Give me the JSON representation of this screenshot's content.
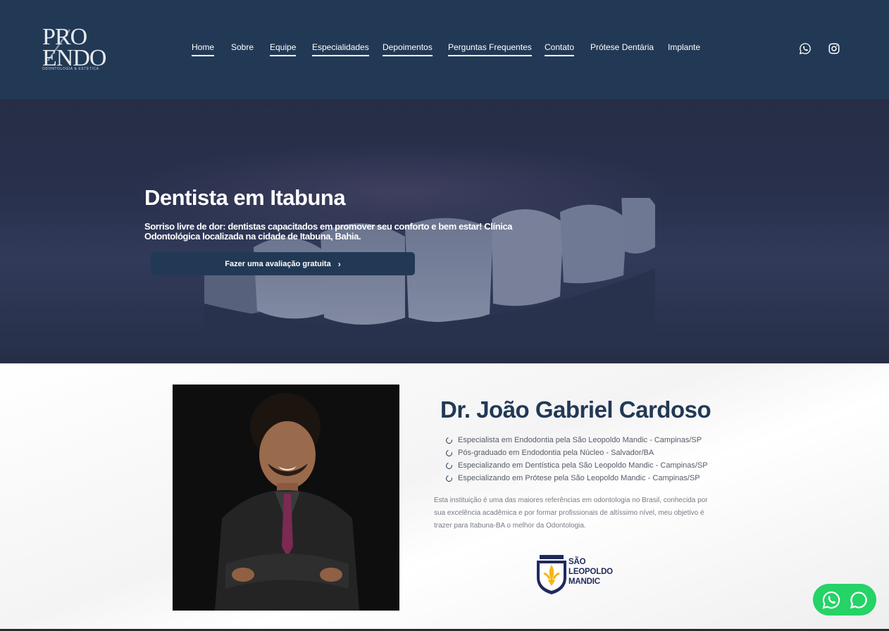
{
  "brand": {
    "logo_line1": "PRO",
    "logo_line2": "ENDO",
    "logo_tagline": "ODONTOLOGIA & ESTÉTICA"
  },
  "nav": {
    "items": [
      {
        "label": "Home"
      },
      {
        "label": "Sobre"
      },
      {
        "label": "Equipe"
      },
      {
        "label": "Especialidades"
      },
      {
        "label": "Depoimentos"
      },
      {
        "label": "Perguntas Frequentes"
      },
      {
        "label": "Contato"
      },
      {
        "label": "Prótese Dentária"
      },
      {
        "label": "Implante"
      }
    ]
  },
  "social": {
    "whatsapp_icon": "whatsapp-icon",
    "instagram_icon": "instagram-icon"
  },
  "hero": {
    "title": "Dentista em Itabuna",
    "subtitle": "Sorriso livre de dor: dentistas capacitados  em promover seu conforto e bem estar! Clínica Odontológica localizada na cidade de Itabuna, Bahia.",
    "cta_label": "Fazer uma avaliação gratuita"
  },
  "doctor": {
    "name": "Dr. João Gabriel Cardoso",
    "qualifications": [
      "Especialista em Endodontia pela São Leopoldo Mandic - Campinas/SP",
      "Pós-graduado em Endodontia pela Núcleo - Salvador/BA",
      "Especializando em Dentística pela São Leopoldo Mandic - Campinas/SP",
      "Especializando em Prótese pela São Leopoldo Mandic - Campinas/SP"
    ],
    "description": "Esta instituição é uma das maiores referências em odontologia no Brasil, conhecida por sua excelência acadêmica e por formar profissionais de altíssimo nível, meu objetivo é trazer para Itabuna-BA o melhor da Odontologia.",
    "institution_line1": "SÃO",
    "institution_line2": "LEOPOLDO",
    "institution_line3": "MANDIC"
  },
  "colors": {
    "brand_navy": "#223955",
    "whatsapp_green": "#25d366"
  }
}
